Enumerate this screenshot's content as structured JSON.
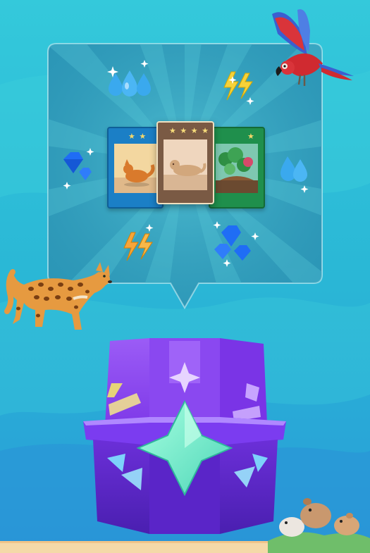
{
  "colors": {
    "sky_top": "#2fc6d8",
    "sky_bottom": "#2b9ed8",
    "panel": "#2a91b2",
    "chest_purple": "#8a3df0",
    "chest_gem": "#7ef0c8",
    "water_drop": "#3aa9ee",
    "lightning": "#f6d23a",
    "lightning_orange": "#f7a53a",
    "diamond": "#1f6df5",
    "card_blue": "#1b7fc6",
    "card_brown": "#7a5a44",
    "card_green": "#1f8f4c",
    "star": "#f6d76a"
  },
  "reward_panel": {
    "icons": [
      "water-drops-icon",
      "lightning-icon",
      "diamond-icon",
      "water-drop-icon",
      "lightning-orange-icon",
      "diamonds-icon"
    ],
    "cards": [
      {
        "art": "fox",
        "stars": "★ ★"
      },
      {
        "art": "cougar",
        "stars": "★ ★ ★ ★"
      },
      {
        "art": "plants",
        "stars": "★"
      }
    ]
  },
  "characters": [
    "parrot",
    "ocelot",
    "guinea-pigs"
  ],
  "chest": {
    "type": "purple-star-chest"
  }
}
